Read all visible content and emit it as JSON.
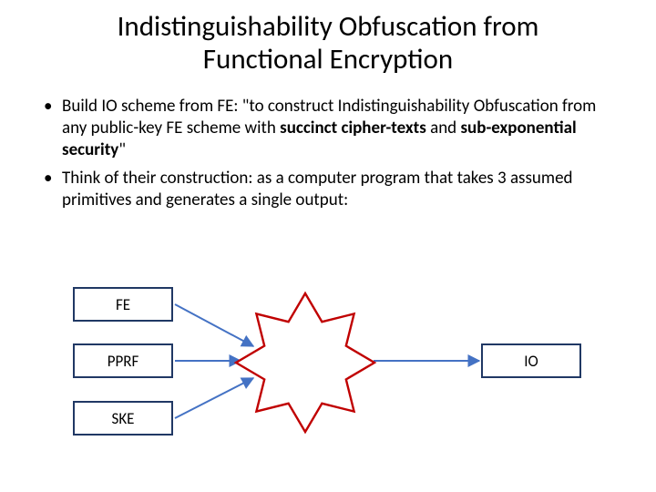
{
  "title_line1": "Indistinguishability Obfuscation from",
  "title_line2": "Functional Encryption",
  "bullets": [
    {
      "prefix": "Build IO scheme from FE: \"to construct Indistinguishability Obfuscation from any public-key FE scheme with ",
      "bold1": "succinct cipher-texts",
      "mid": " and ",
      "bold2": "sub-exponential security",
      "suffix": "\""
    },
    {
      "text": "Think of their construction: as a computer program that takes 3 assumed primitives and generates a single output:"
    }
  ],
  "inputs": [
    "FE",
    "PPRF",
    "SKE"
  ],
  "output": "IO",
  "colors": {
    "box_border": "#203864",
    "arrow": "#4472C4",
    "star": "#C00000"
  }
}
